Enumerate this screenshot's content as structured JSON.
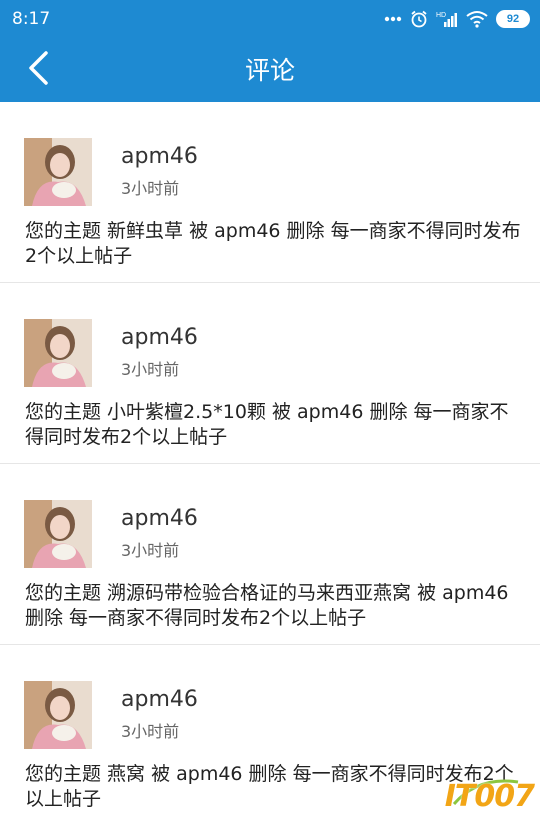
{
  "status_bar": {
    "time": "8:17",
    "battery": "92",
    "network_label": "HD",
    "icons": [
      "dots-icon",
      "alarm-icon",
      "signal-icon",
      "wifi-icon",
      "battery-icon"
    ]
  },
  "header": {
    "title": "评论",
    "background_color": "#1e8ad2"
  },
  "comments": [
    {
      "username": "apm46",
      "time": "3小时前",
      "message": "您的主题 新鲜虫草 被 apm46 删除 每一商家不得同时发布2个以上帖子"
    },
    {
      "username": "apm46",
      "time": "3小时前",
      "message": "您的主题 小叶紫檀2.5*10颗 被 apm46 删除 每一商家不得同时发布2个以上帖子"
    },
    {
      "username": "apm46",
      "time": "3小时前",
      "message": "您的主题 溯源码带检验合格证的马来西亚燕窝 被 apm46 删除 每一商家不得同时发布2个以上帖子"
    },
    {
      "username": "apm46",
      "time": "3小时前",
      "message": "您的主题 燕窝 被 apm46 删除 每一商家不得同时发布2个以上帖子"
    }
  ],
  "watermark": {
    "text": "IT007"
  }
}
